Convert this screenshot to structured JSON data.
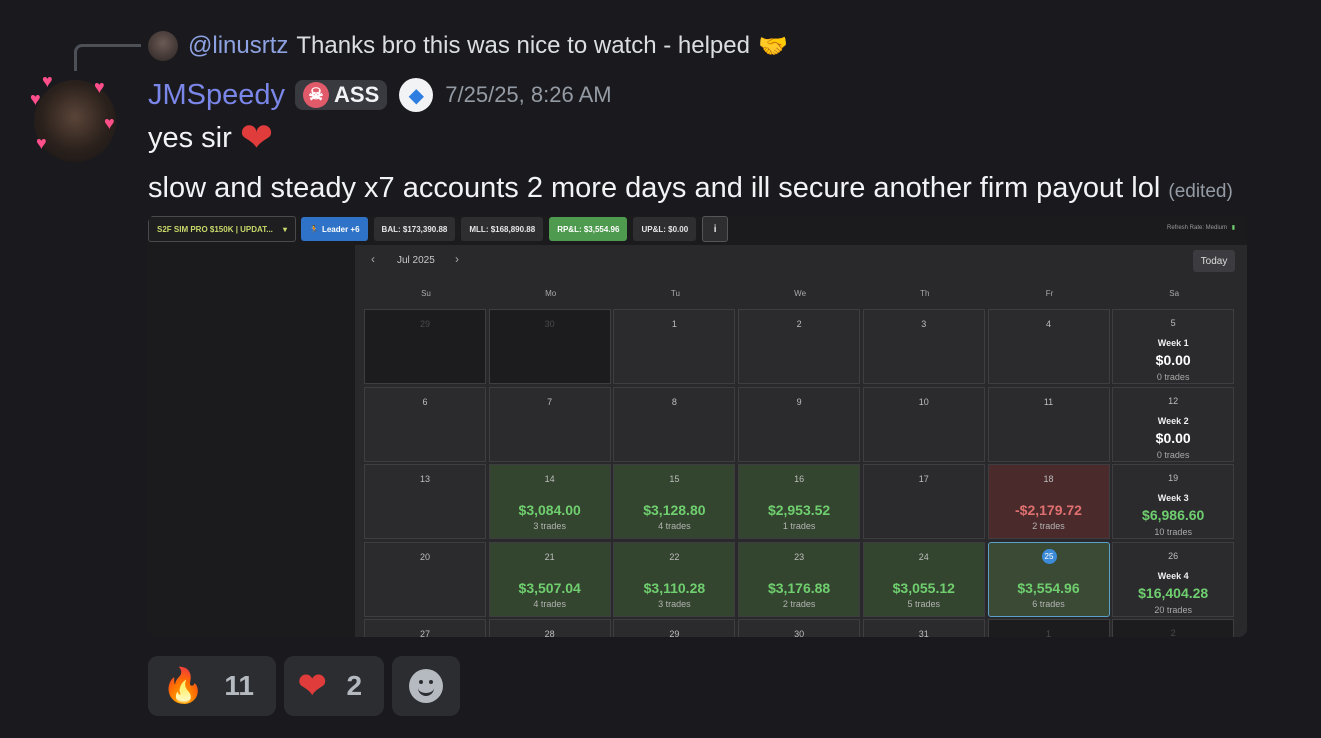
{
  "reply": {
    "mention": "@linusrtz",
    "text": "Thanks bro this was nice to watch - helped",
    "emoji": "🤝"
  },
  "author": {
    "username": "JMSpeedy",
    "tag_label": "ASS",
    "timestamp": "7/25/25, 8:26 AM"
  },
  "messages": {
    "first": "yes sir",
    "first_emoji": "❤",
    "second": "slow and steady x7 accounts 2 more days and ill secure another firm payout lol",
    "edited": "(edited)"
  },
  "screenshot": {
    "account": "S2F SIM PRO $150K | UPDAT...",
    "leader": "Leader +6",
    "bal": "BAL: $173,390.88",
    "mll": "MLL: $168,890.88",
    "rpl": "RP&L: $3,554.96",
    "upl": "UP&L: $0.00",
    "info_icon": "i",
    "refresh": "Refresh Rate: Medium",
    "month": "Jul 2025",
    "today_label": "Today",
    "days_of_week": [
      "Su",
      "Mo",
      "Tu",
      "We",
      "Th",
      "Fr",
      "Sa"
    ],
    "weeks": [
      {
        "cells": [
          {
            "d": "29",
            "dim": true
          },
          {
            "d": "30",
            "dim": true
          },
          {
            "d": "1"
          },
          {
            "d": "2"
          },
          {
            "d": "3"
          },
          {
            "d": "4"
          }
        ],
        "week": {
          "title": "Week 1",
          "d": "5",
          "value": "$0.00",
          "trades": "0 trades"
        }
      },
      {
        "cells": [
          {
            "d": "6"
          },
          {
            "d": "7"
          },
          {
            "d": "8"
          },
          {
            "d": "9"
          },
          {
            "d": "10"
          },
          {
            "d": "11"
          }
        ],
        "week": {
          "title": "Week 2",
          "d": "12",
          "value": "$0.00",
          "trades": "0 trades"
        }
      },
      {
        "cells": [
          {
            "d": "13"
          },
          {
            "d": "14",
            "pnl": "$3,084.00",
            "trades": "3 trades",
            "kind": "green"
          },
          {
            "d": "15",
            "pnl": "$3,128.80",
            "trades": "4 trades",
            "kind": "green"
          },
          {
            "d": "16",
            "pnl": "$2,953.52",
            "trades": "1 trades",
            "kind": "green"
          },
          {
            "d": "17"
          },
          {
            "d": "18",
            "pnl": "-$2,179.72",
            "trades": "2 trades",
            "kind": "red"
          }
        ],
        "week": {
          "title": "Week 3",
          "d": "19",
          "value": "$6,986.60",
          "trades": "10 trades",
          "pos": true
        }
      },
      {
        "cells": [
          {
            "d": "20"
          },
          {
            "d": "21",
            "pnl": "$3,507.04",
            "trades": "4 trades",
            "kind": "green"
          },
          {
            "d": "22",
            "pnl": "$3,110.28",
            "trades": "3 trades",
            "kind": "green"
          },
          {
            "d": "23",
            "pnl": "$3,176.88",
            "trades": "2 trades",
            "kind": "green"
          },
          {
            "d": "24",
            "pnl": "$3,055.12",
            "trades": "5 trades",
            "kind": "green"
          },
          {
            "d": "25",
            "pnl": "$3,554.96",
            "trades": "6 trades",
            "kind": "today"
          }
        ],
        "week": {
          "title": "Week 4",
          "d": "26",
          "value": "$16,404.28",
          "trades": "20 trades",
          "pos": true
        }
      },
      {
        "cells": [
          {
            "d": "27"
          },
          {
            "d": "28"
          },
          {
            "d": "29"
          },
          {
            "d": "30"
          },
          {
            "d": "31"
          },
          {
            "d": "1",
            "dim": true
          }
        ],
        "week": {
          "d": "2",
          "dim": true
        }
      }
    ]
  },
  "reactions": [
    {
      "emoji": "🔥",
      "count": "11"
    },
    {
      "emoji": "❤",
      "count": "2"
    }
  ],
  "colors": {
    "username": "#7a86e8",
    "mention": "#8ea1e1",
    "profit": "#6fcf6f",
    "loss": "#e07070"
  }
}
